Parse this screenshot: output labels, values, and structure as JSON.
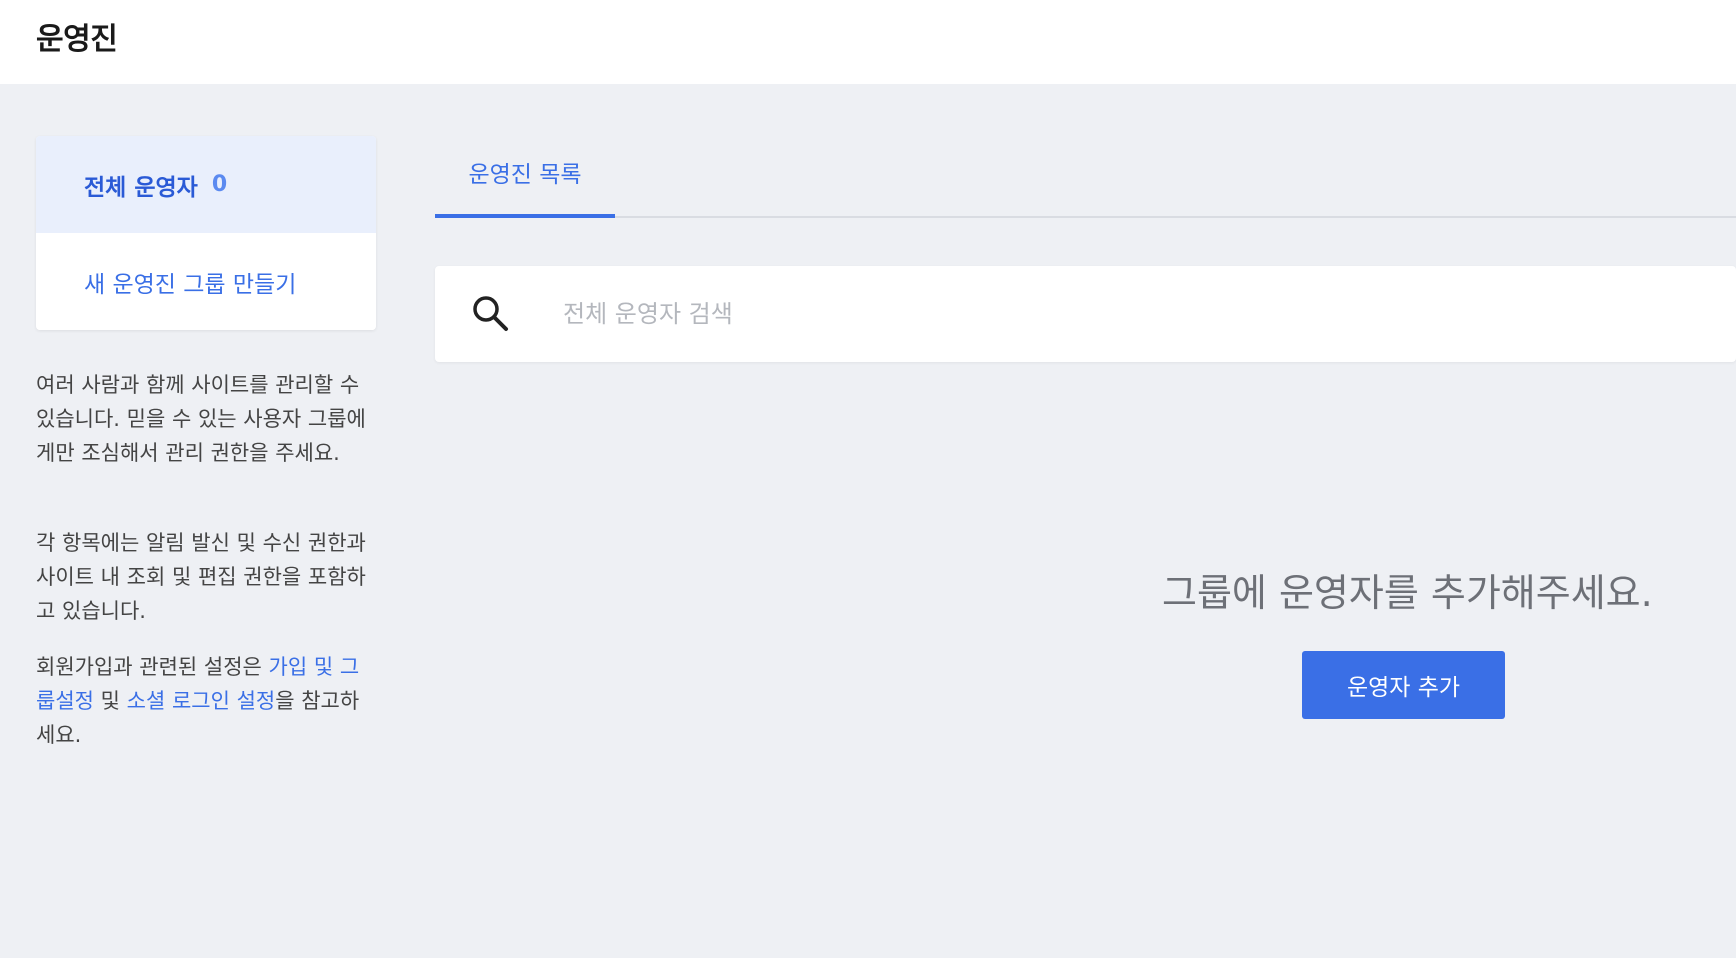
{
  "header": {
    "title": "운영진"
  },
  "sidebar": {
    "all_label": "전체 운영자",
    "all_count": "0",
    "create_label": "새 운영진 그룹 만들기"
  },
  "description": {
    "p1": "여러 사람과 함께 사이트를 관리할 수 있습니다. 믿을 수 있는 사용자 그룹에게만 조심해서 관리 권한을 주세요.",
    "p2": "각 항목에는 알림 발신 및 수신 권한과 사이트 내 조회 및 편집 권한을 포함하고 있습니다.",
    "p3_prefix": "회원가입과 관련된 설정은 ",
    "p3_link1": "가입 및 그룹설정",
    "p3_middle": " 및 ",
    "p3_link2": "소셜 로그인 설정",
    "p3_suffix": "을 참고하세요."
  },
  "main": {
    "tabs": [
      {
        "label": "운영진 목록"
      }
    ],
    "search": {
      "placeholder": "전체 운영자 검색"
    },
    "empty_message": "그룹에 운영자를 추가해주세요.",
    "add_button_label": "운영자 추가"
  },
  "colors": {
    "accent": "#3a6fe6",
    "background": "#eef0f4"
  },
  "icons": {
    "search": "search-icon"
  }
}
